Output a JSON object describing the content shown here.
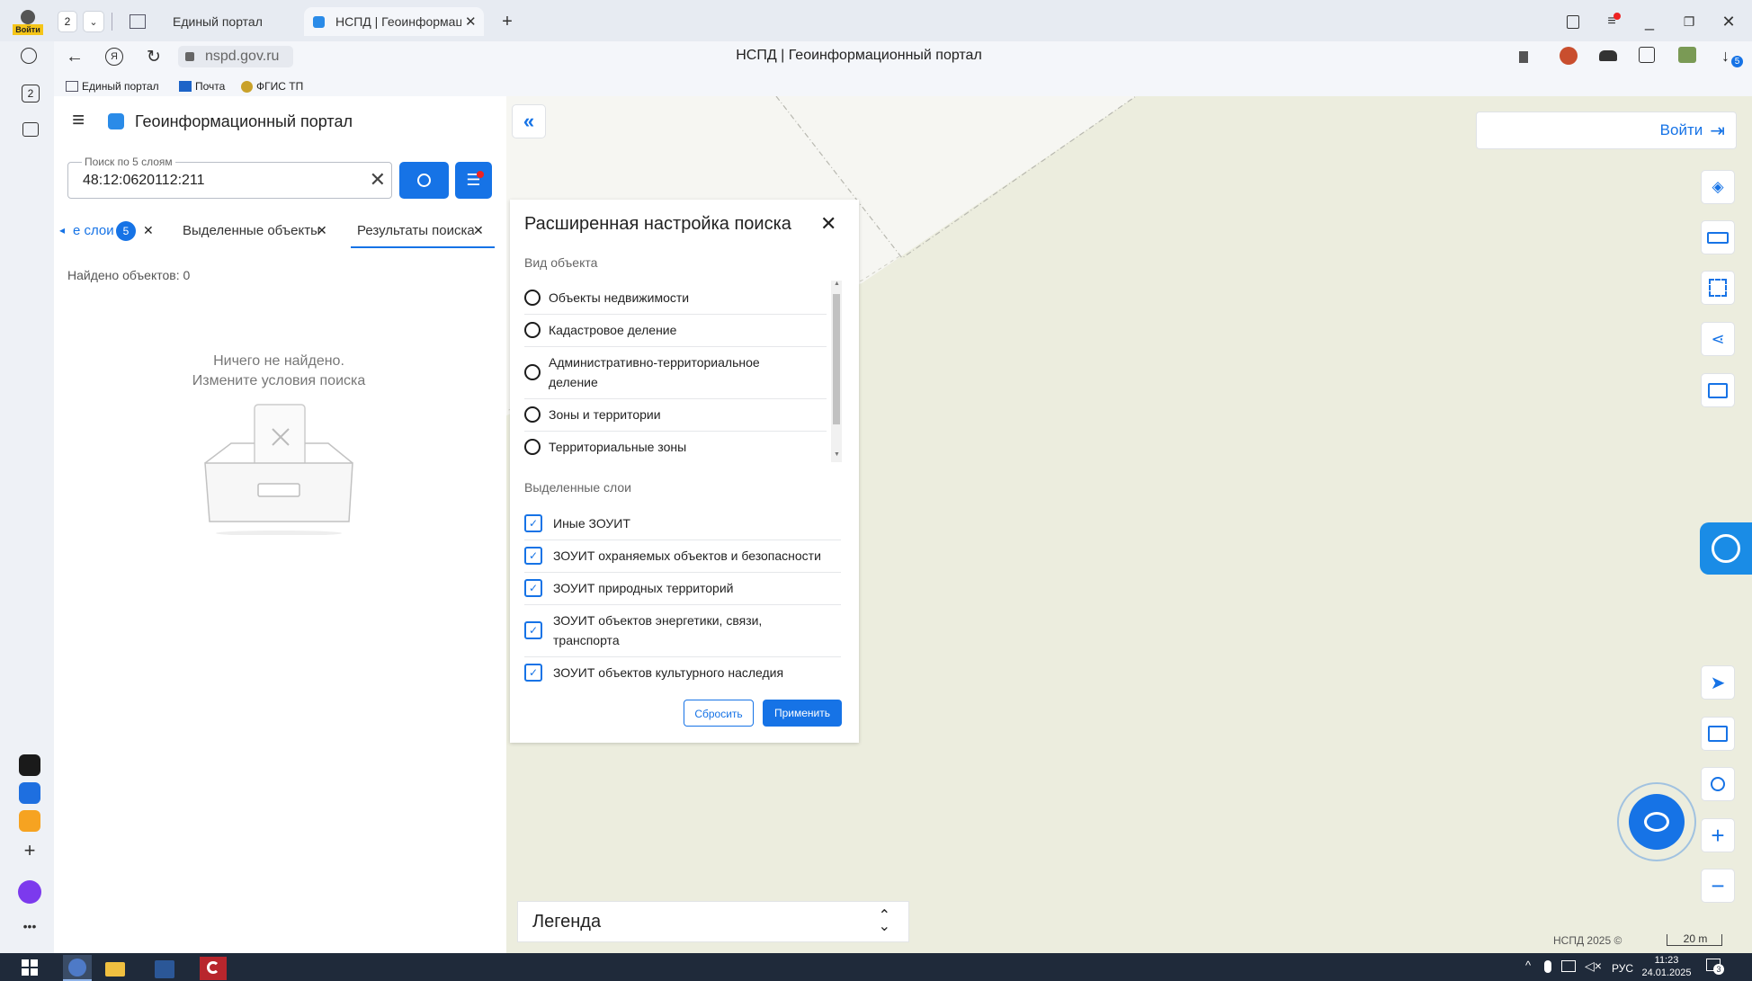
{
  "browser": {
    "profile_label": "Войти",
    "tab_count": "2",
    "tabs": [
      {
        "label": "Единый портал"
      },
      {
        "label": "НСПД | Геоинформаци"
      }
    ],
    "address": "nspd.gov.ru",
    "page_title": "НСПД | Геоинформационный портал",
    "bookmarks": [
      "Единый портал",
      "Почта",
      "ФГИС ТП"
    ],
    "side_counter": "2",
    "extension_badge": "5"
  },
  "portal": {
    "title": "Геоинформационный портал",
    "search": {
      "label": "Поиск по 5 слоям",
      "value": "48:12:0620112:211"
    },
    "tabs": {
      "layers_label": "е слои",
      "layers_count": "5",
      "selected_label": "Выделенные объекты",
      "results_label": "Результаты поиска"
    },
    "found_text": "Найдено объектов: 0",
    "empty_line1": "Ничего не найдено.",
    "empty_line2": "Измените условия поиска"
  },
  "dialog": {
    "title": "Расширенная настройка поиска",
    "object_type_label": "Вид объекта",
    "object_types": [
      "Объекты недвижимости",
      "Кадастровое деление",
      "Административно-территориальное",
      "деление",
      "Зоны и территории",
      "Территориальные зоны"
    ],
    "selected_layers_label": "Выделенные слои",
    "layers": [
      "Иные ЗОУИТ",
      "ЗОУИТ охраняемых объектов и безопасности",
      "ЗОУИТ природных территорий",
      "ЗОУИТ объектов энергетики, связи,",
      "транспорта",
      "ЗОУИТ объектов культурного наследия"
    ],
    "reset_label": "Сбросить",
    "apply_label": "Применить"
  },
  "map": {
    "login_label": "Войти",
    "legend_label": "Легенда",
    "copyright": "НСПД 2025 ©",
    "scale": "20 m"
  },
  "taskbar": {
    "lang": "РУС",
    "time": "11:23",
    "date": "24.01.2025",
    "notif_count": "3"
  },
  "colors": {
    "accent": "#1673e6",
    "map_bg": "#ecedde",
    "taskbar": "#1f2a3a"
  }
}
